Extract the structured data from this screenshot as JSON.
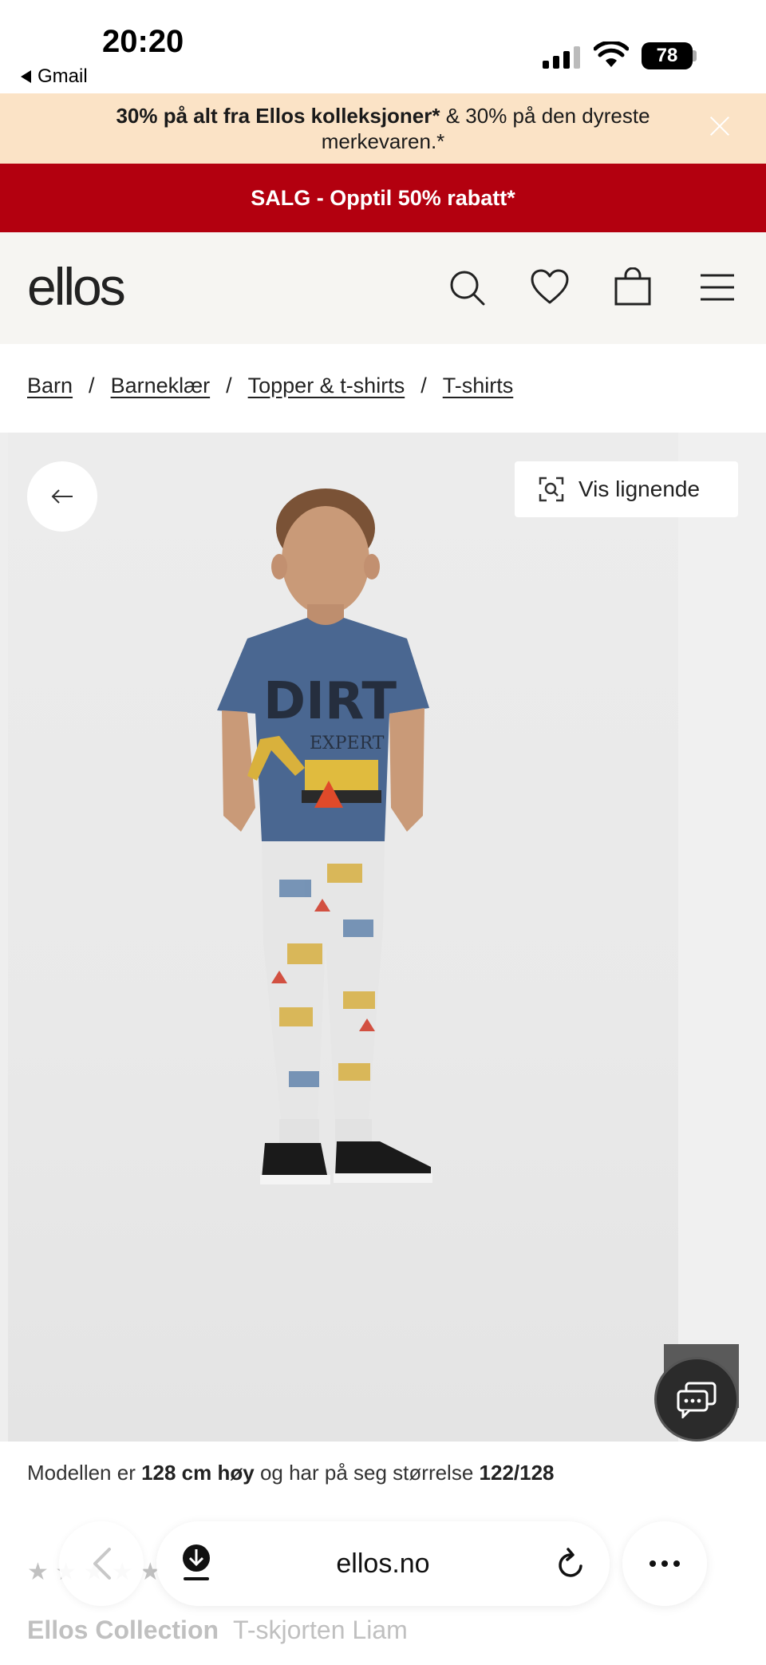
{
  "status_bar": {
    "time": "20:20",
    "back_app": "Gmail",
    "battery": "78"
  },
  "promo": {
    "bold_text": "30% på alt fra Ellos kolleksjoner*",
    "rest_text": " & 30% på den dyreste merkevaren.*"
  },
  "sale": {
    "text": "SALG - Opptil 50% rabatt*"
  },
  "header": {
    "logo": "ellos"
  },
  "breadcrumb": {
    "items": [
      "Barn",
      "Barneklær",
      "Topper & t-shirts",
      "T-shirts"
    ],
    "separator": "/"
  },
  "gallery": {
    "similar_label": "Vis lignende"
  },
  "model_info": {
    "prefix": "Modellen er ",
    "height": "128 cm høy",
    "middle": " og har på seg størrelse ",
    "size": "122/128"
  },
  "product": {
    "brand": "Ellos Collection",
    "name": "T-skjorten Liam"
  },
  "browser": {
    "url": "ellos.no"
  },
  "colors": {
    "promo_bg": "#fbe3c6",
    "sale_bg": "#b3000f",
    "header_bg": "#f6f5f2",
    "shirt": "#4a6791"
  }
}
